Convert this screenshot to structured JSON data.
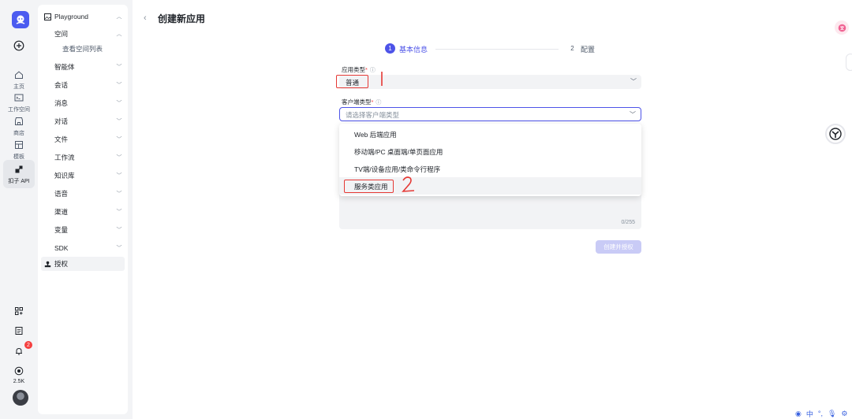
{
  "rail": {
    "items": [
      {
        "label": "主页",
        "icon": "home-icon"
      },
      {
        "label": "工作空间",
        "icon": "folder-terminal-icon"
      },
      {
        "label": "商店",
        "icon": "store-icon"
      },
      {
        "label": "模板",
        "icon": "template-icon"
      },
      {
        "label": "扣子 API",
        "icon": "api-icon"
      }
    ],
    "bottom": {
      "notification_count": "2",
      "stat_value": "2.5K"
    }
  },
  "sidebar": {
    "header": "Playground",
    "items": [
      {
        "label": "空间"
      },
      {
        "label": "查看空间列表"
      },
      {
        "label": "智能体"
      },
      {
        "label": "会话"
      },
      {
        "label": "消息"
      },
      {
        "label": "对话"
      },
      {
        "label": "文件"
      },
      {
        "label": "工作流"
      },
      {
        "label": "知识库"
      },
      {
        "label": "语音"
      },
      {
        "label": "渠道"
      },
      {
        "label": "变量"
      },
      {
        "label": "SDK"
      },
      {
        "label": "授权"
      }
    ]
  },
  "page": {
    "back": "‹",
    "title": "创建新应用"
  },
  "steps": [
    {
      "num": "1",
      "label": "基本信息"
    },
    {
      "num": "2",
      "label": "配置"
    }
  ],
  "form": {
    "app_type_label": "应用类型",
    "app_type_value": "普通",
    "client_type_label": "客户端类型",
    "client_type_placeholder": "请选择客户端类型",
    "required_mark": "*",
    "info_mark": "ⓘ",
    "desc_counter": "0/255",
    "create_button": "创建并授权"
  },
  "dropdown": {
    "options": [
      "Web 后端应用",
      "移动端/PC 桌面端/单页面应用",
      "TV端/设备应用/类命令行程序",
      "服务类应用"
    ]
  },
  "annotations": {
    "mark_1": "1",
    "mark_2": "2"
  },
  "ime": {
    "lang": "中"
  },
  "colors": {
    "accent": "#4d53e8",
    "annotation_red": "#e53935",
    "disabled_button": "#c9cbf6"
  }
}
